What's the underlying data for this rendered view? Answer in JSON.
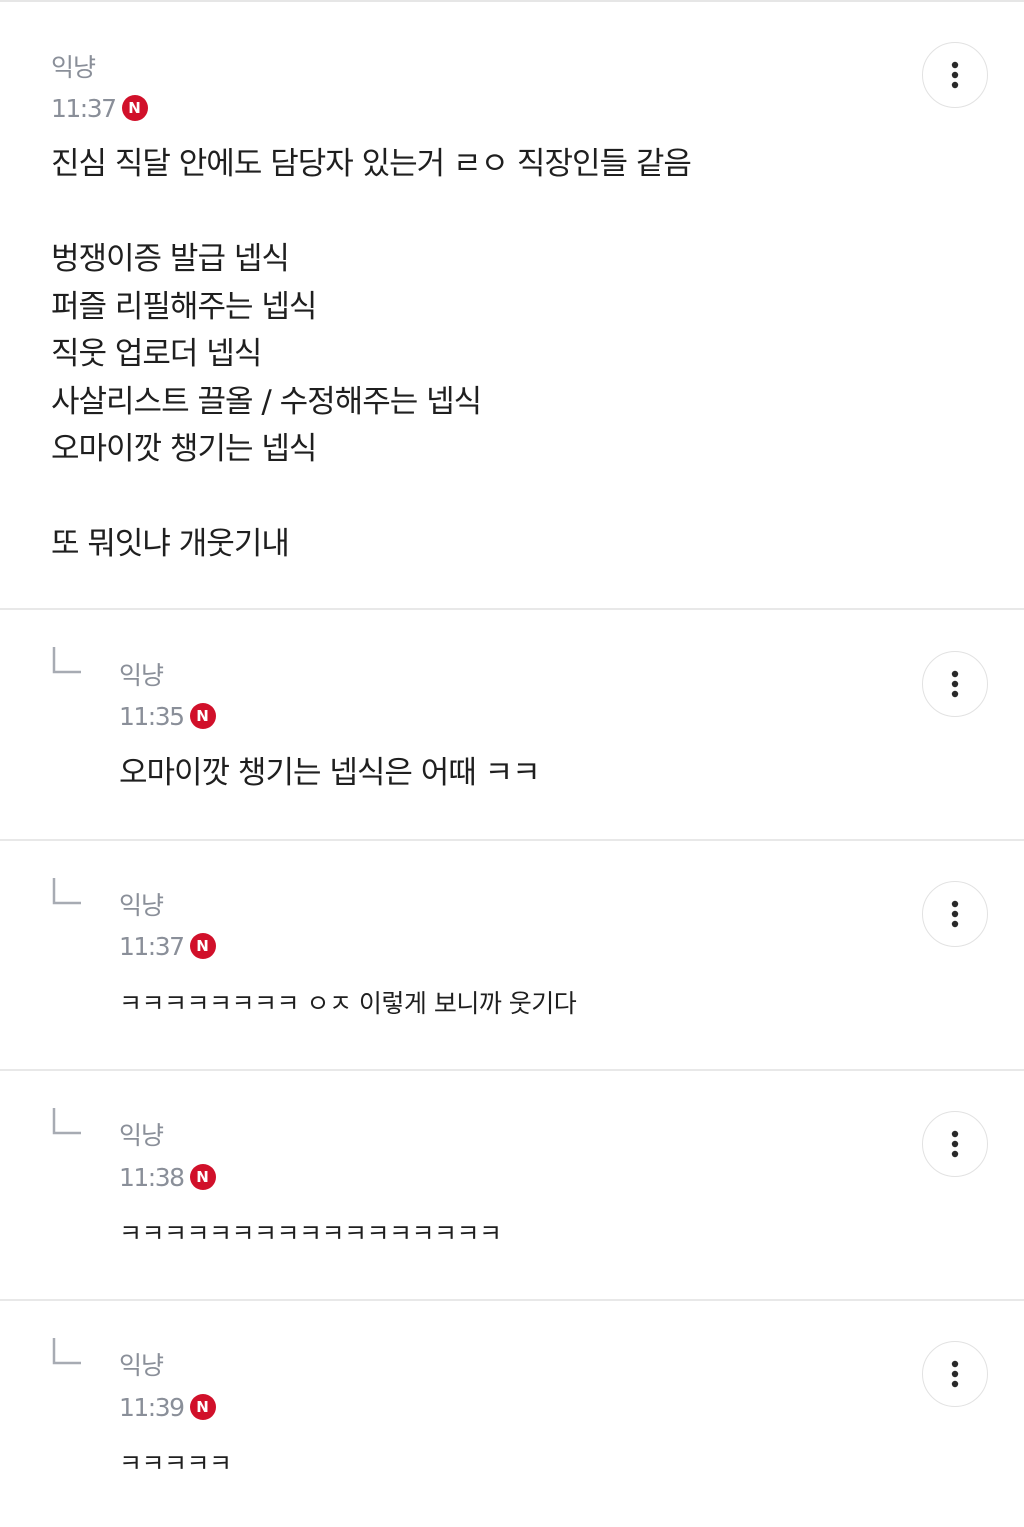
{
  "comments": [
    {
      "author": "익냥",
      "time": "11:37",
      "badge": "N",
      "text": "진심 직달 안에도 담당자 있는거 ㄹㅇ 직장인들 같음\n\n벙쟁이증 발급 넵식\n퍼즐 리필해주는 넵식\n직웃 업로더 넵식\n사살리스트 끌올 / 수정해주는 넵식\n오마이깟 챙기는 넵식\n\n또 뭐잇냐 개웃기내"
    },
    {
      "author": "익냥",
      "time": "11:35",
      "badge": "N",
      "text": "오마이깟 챙기는 넵식은 어때 ㅋㅋ"
    },
    {
      "author": "익냥",
      "time": "11:37",
      "badge": "N",
      "text": "ㅋㅋㅋㅋㅋㅋㅋㅋ ㅇㅈ 이렇게 보니까 웃기다"
    },
    {
      "author": "익냥",
      "time": "11:38",
      "badge": "N",
      "text": "ㅋㅋㅋㅋㅋㅋㅋㅋㅋㅋㅋㅋㅋㅋㅋㅋㅋ"
    },
    {
      "author": "익냥",
      "time": "11:39",
      "badge": "N",
      "text": "ㅋㅋㅋㅋㅋ"
    }
  ],
  "icons": {
    "more": "more-vertical-icon",
    "reply": "reply-arrow-icon"
  },
  "colors": {
    "badge": "#d1102a",
    "meta": "#8a8f99",
    "divider": "#e8e8e8"
  }
}
